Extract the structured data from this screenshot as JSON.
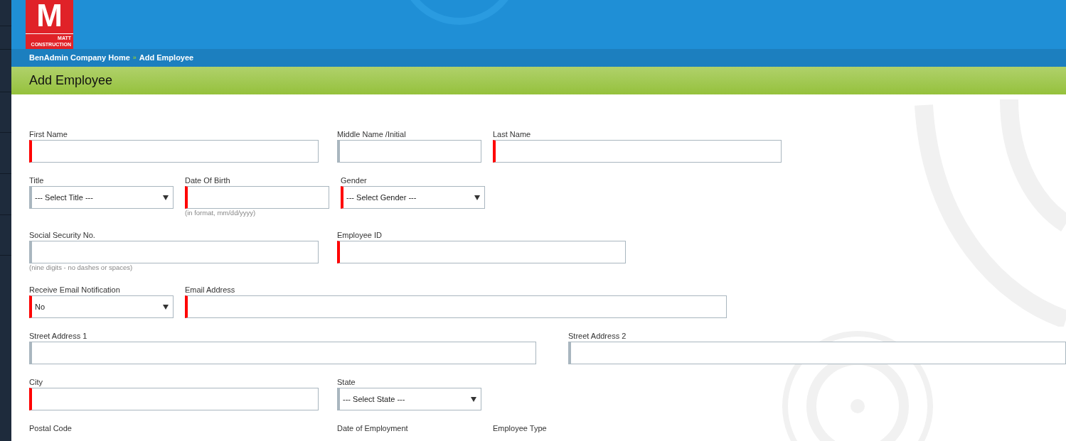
{
  "logo": {
    "letter": "M",
    "lines": [
      "MATT",
      "CONSTRUCTION"
    ]
  },
  "breadcrumb": {
    "items": [
      "BenAdmin Company Home",
      "Add Employee"
    ],
    "separator": "»"
  },
  "page_title": "Add Employee",
  "form": {
    "rows": [
      {
        "fields": [
          {
            "kind": "text",
            "label": "First Name",
            "required": true
          },
          {
            "kind": "text",
            "label": "Middle Name /Initial",
            "required": false
          },
          {
            "kind": "text",
            "label": "Last Name",
            "required": true
          }
        ]
      },
      {
        "fields": [
          {
            "kind": "select",
            "label": "Title",
            "required": false,
            "value": "--- Select Title ---"
          },
          {
            "kind": "text",
            "label": "Date Of Birth",
            "required": true,
            "hint": "(in format, mm/dd/yyyy)"
          },
          {
            "kind": "select",
            "label": "Gender",
            "required": true,
            "value": "--- Select Gender ---"
          }
        ]
      },
      {
        "fields": [
          {
            "kind": "text",
            "label": "Social Security No.",
            "required": false,
            "hint": "(nine digits - no dashes or spaces)"
          },
          {
            "kind": "text",
            "label": "Employee ID",
            "required": true
          }
        ]
      },
      {
        "fields": [
          {
            "kind": "select",
            "label": "Receive Email Notification",
            "required": true,
            "value": "No"
          },
          {
            "kind": "text",
            "label": "Email Address",
            "required": true
          }
        ]
      },
      {
        "fields": [
          {
            "kind": "text",
            "label": "Street Address 1",
            "required": false
          },
          {
            "kind": "text",
            "label": "Street Address 2",
            "required": false
          }
        ]
      },
      {
        "fields": [
          {
            "kind": "text",
            "label": "City",
            "required": true
          },
          {
            "kind": "select",
            "label": "State",
            "required": false,
            "value": "--- Select State ---"
          }
        ]
      },
      {
        "fields": [
          {
            "kind": "label",
            "label": "Postal Code"
          },
          {
            "kind": "label",
            "label": "Date of Employment"
          },
          {
            "kind": "label",
            "label": "Employee Type"
          }
        ]
      }
    ]
  }
}
